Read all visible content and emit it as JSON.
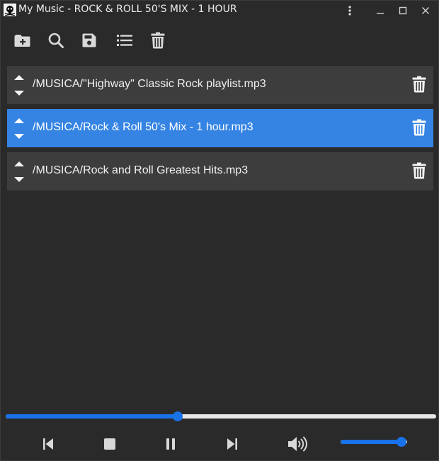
{
  "window": {
    "title": "My Music - ROCK & ROLL 50'S MIX - 1 HOUR",
    "icon": "pirate-skull-icon"
  },
  "titlebar_buttons": [
    "kebab-menu-icon",
    "minimize-icon",
    "maximize-icon",
    "close-icon"
  ],
  "toolbar": {
    "items": [
      {
        "name": "add-folder-button",
        "icon": "folder-plus-icon"
      },
      {
        "name": "search-button",
        "icon": "search-icon"
      },
      {
        "name": "save-button",
        "icon": "floppy-disk-icon"
      },
      {
        "name": "playlist-button",
        "icon": "list-icon"
      },
      {
        "name": "clear-button",
        "icon": "trash-icon"
      }
    ]
  },
  "playlist": {
    "items": [
      {
        "path": "/MUSICA/\"Highway\" Classic Rock playlist.mp3",
        "selected": false
      },
      {
        "path": "/MUSICA/Rock & Roll 50's Mix - 1 hour.mp3",
        "selected": true
      },
      {
        "path": "/MUSICA/Rock and Roll Greatest Hits.mp3",
        "selected": false
      }
    ]
  },
  "playback": {
    "progress_fraction": 0.4,
    "volume_fraction": 0.92
  },
  "controls": [
    "previous-icon",
    "stop-icon",
    "pause-icon",
    "next-icon",
    "volume-high-icon"
  ],
  "colors": {
    "background": "#2a2a2a",
    "row": "#3d3d3d",
    "selected_row": "#3584e4",
    "accent": "#1a72e8",
    "track": "#e8e8e8",
    "icon": "#d8d8d8"
  }
}
